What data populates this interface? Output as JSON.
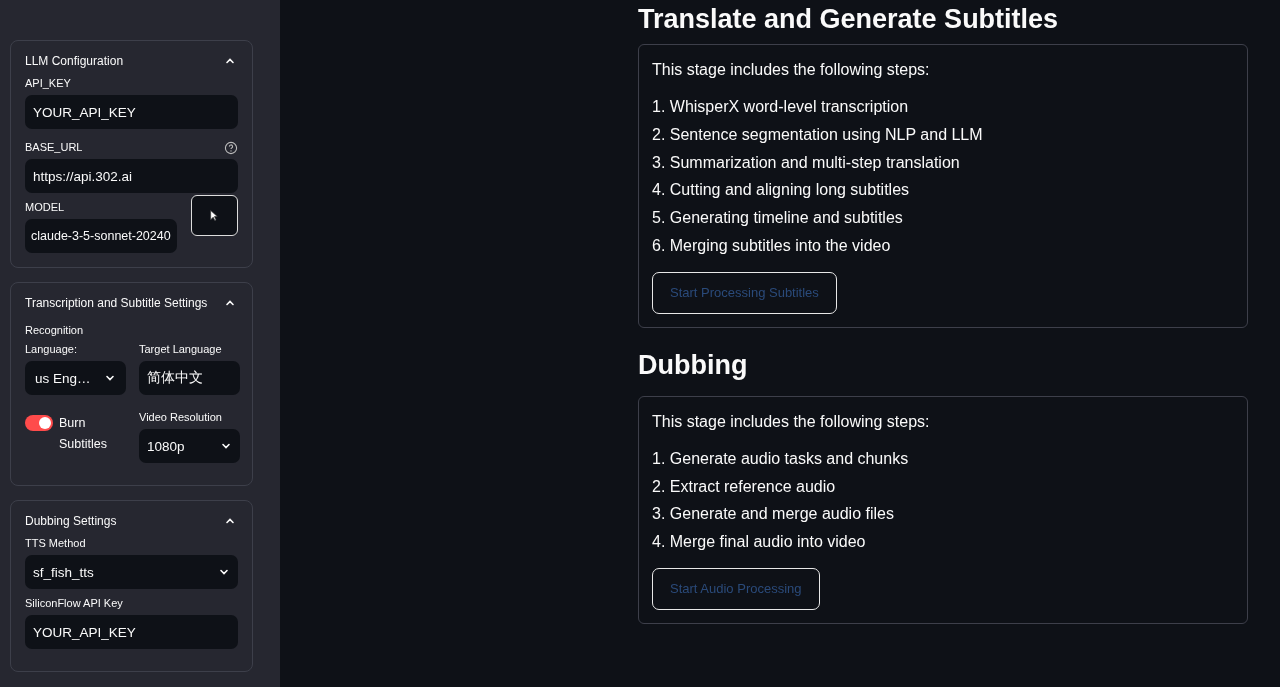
{
  "sidebar": {
    "sections": [
      {
        "title": "LLM Configuration",
        "expanded": true,
        "kind": "llm",
        "api_key": {
          "label": "API_KEY",
          "value": "YOUR_API_KEY"
        },
        "base_url": {
          "label": "BASE_URL",
          "value": "https://api.302.ai"
        },
        "model": {
          "label": "MODEL",
          "value": "claude-3-5-sonnet-20240"
        }
      },
      {
        "title": "Transcription and Subtitle Settings",
        "expanded": true,
        "kind": "subtitle",
        "recognition_language": {
          "label": "Recognition Language:",
          "value": "us Eng…"
        },
        "target_language": {
          "label": "Target Language",
          "value": "简体中文"
        },
        "burn_subtitles": {
          "label": "Burn Subtitles",
          "on": true
        },
        "video_resolution": {
          "label": "Video Resolution",
          "value": "1080p"
        }
      },
      {
        "title": "Dubbing Settings",
        "expanded": true,
        "kind": "dubbing",
        "tts_method": {
          "label": "TTS Method",
          "value": "sf_fish_tts"
        },
        "api_key": {
          "label": "SiliconFlow API Key",
          "value": "YOUR_API_KEY"
        }
      }
    ]
  },
  "stages": [
    {
      "title": "Translate and Generate Subtitles",
      "intro": "This stage includes the following steps:",
      "steps": [
        "1. WhisperX word-level transcription",
        "2. Sentence segmentation using NLP and LLM",
        "3. Summarization and multi-step translation",
        "4. Cutting and aligning long subtitles",
        "5. Generating timeline and subtitles",
        "6. Merging subtitles into the video"
      ],
      "button": "Start Processing Subtitles"
    },
    {
      "title": "Dubbing",
      "intro": "This stage includes the following steps:",
      "steps": [
        "1. Generate audio tasks and chunks",
        "2. Extract reference audio",
        "3. Generate and merge audio files",
        "4. Merge final audio into video"
      ],
      "button": "Start Audio Processing"
    }
  ]
}
